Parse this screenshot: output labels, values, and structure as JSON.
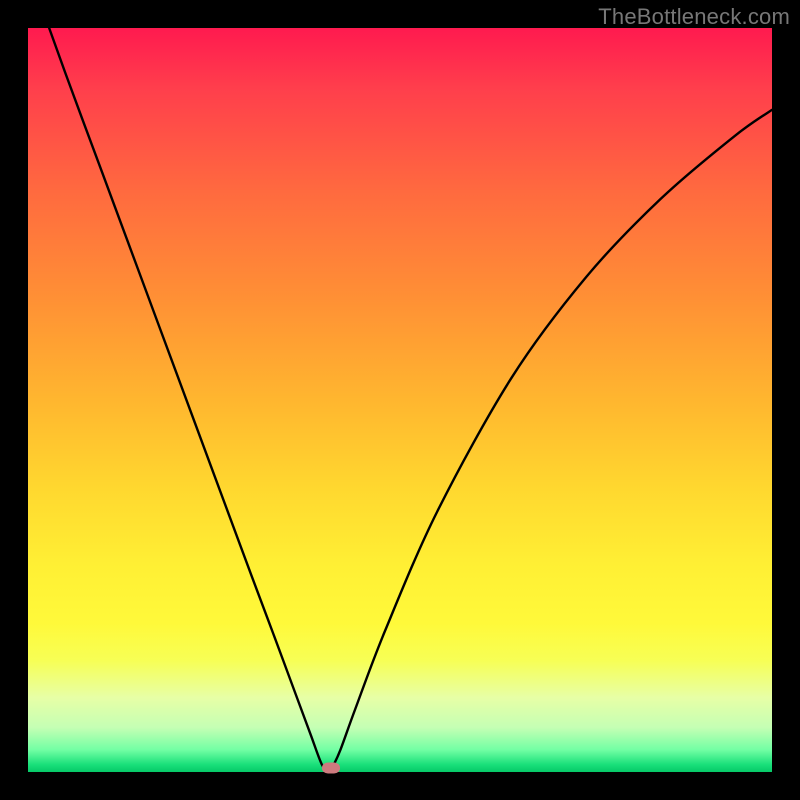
{
  "watermark": "TheBottleneck.com",
  "chart_data": {
    "type": "line",
    "title": "",
    "xlabel": "",
    "ylabel": "",
    "xlim": [
      0,
      100
    ],
    "ylim": [
      0,
      100
    ],
    "grid": false,
    "legend": false,
    "series": [
      {
        "name": "absolute-deviation-curve",
        "x": [
          0,
          5,
          10,
          15,
          20,
          25,
          30,
          33,
          36,
          38,
          39.5,
          40.5,
          41,
          42,
          44,
          48,
          55,
          65,
          75,
          85,
          95,
          100
        ],
        "y": [
          108,
          94,
          80.5,
          67,
          53.5,
          40,
          26.5,
          18.5,
          10.4,
          5,
          1,
          0,
          0.8,
          3,
          8.5,
          19,
          35,
          53,
          66.5,
          77,
          85.5,
          89
        ]
      }
    ],
    "annotations": [
      {
        "name": "optimal-marker",
        "x": 40.7,
        "y": 0.6,
        "color": "#cd7a7e"
      }
    ],
    "colors": {
      "gradient_top": "#ff1a4f",
      "gradient_mid": "#ffe233",
      "gradient_bottom": "#06c968",
      "curve": "#000000",
      "marker": "#cd7a7e",
      "frame": "#000000"
    }
  }
}
